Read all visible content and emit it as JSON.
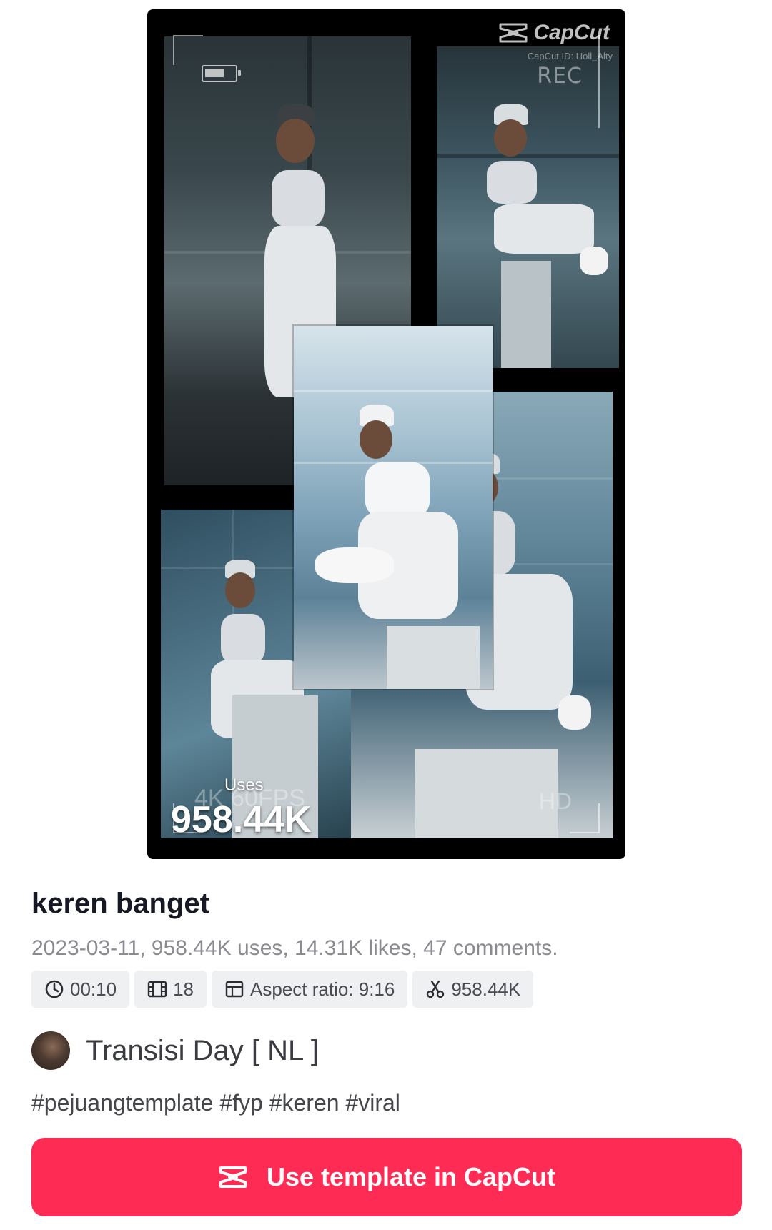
{
  "preview": {
    "watermark_brand": "CapCut",
    "watermark_sub": "CapCut ID: Holl_Alty",
    "rec_label": "REC",
    "fps_label": "4K 60FPS",
    "hd_label": "HD",
    "uses_label": "Uses",
    "uses_value": "958.44K"
  },
  "template": {
    "title": "keren banget",
    "meta": "2023-03-11, 958.44K uses, 14.31K likes, 47 comments."
  },
  "chips": {
    "duration": "00:10",
    "clips": "18",
    "aspect_ratio": "Aspect ratio: 9:16",
    "uses": "958.44K"
  },
  "author": {
    "name": "Transisi Day [ NL ]"
  },
  "hashtags": "#pejuangtemplate #fyp #keren #viral",
  "cta": {
    "label": "Use template in CapCut",
    "color": "#fe2c55"
  },
  "icons": [
    "clock-icon",
    "film-icon",
    "aspect-ratio-icon",
    "scissors-icon",
    "capcut-logo-icon",
    "battery-icon"
  ]
}
